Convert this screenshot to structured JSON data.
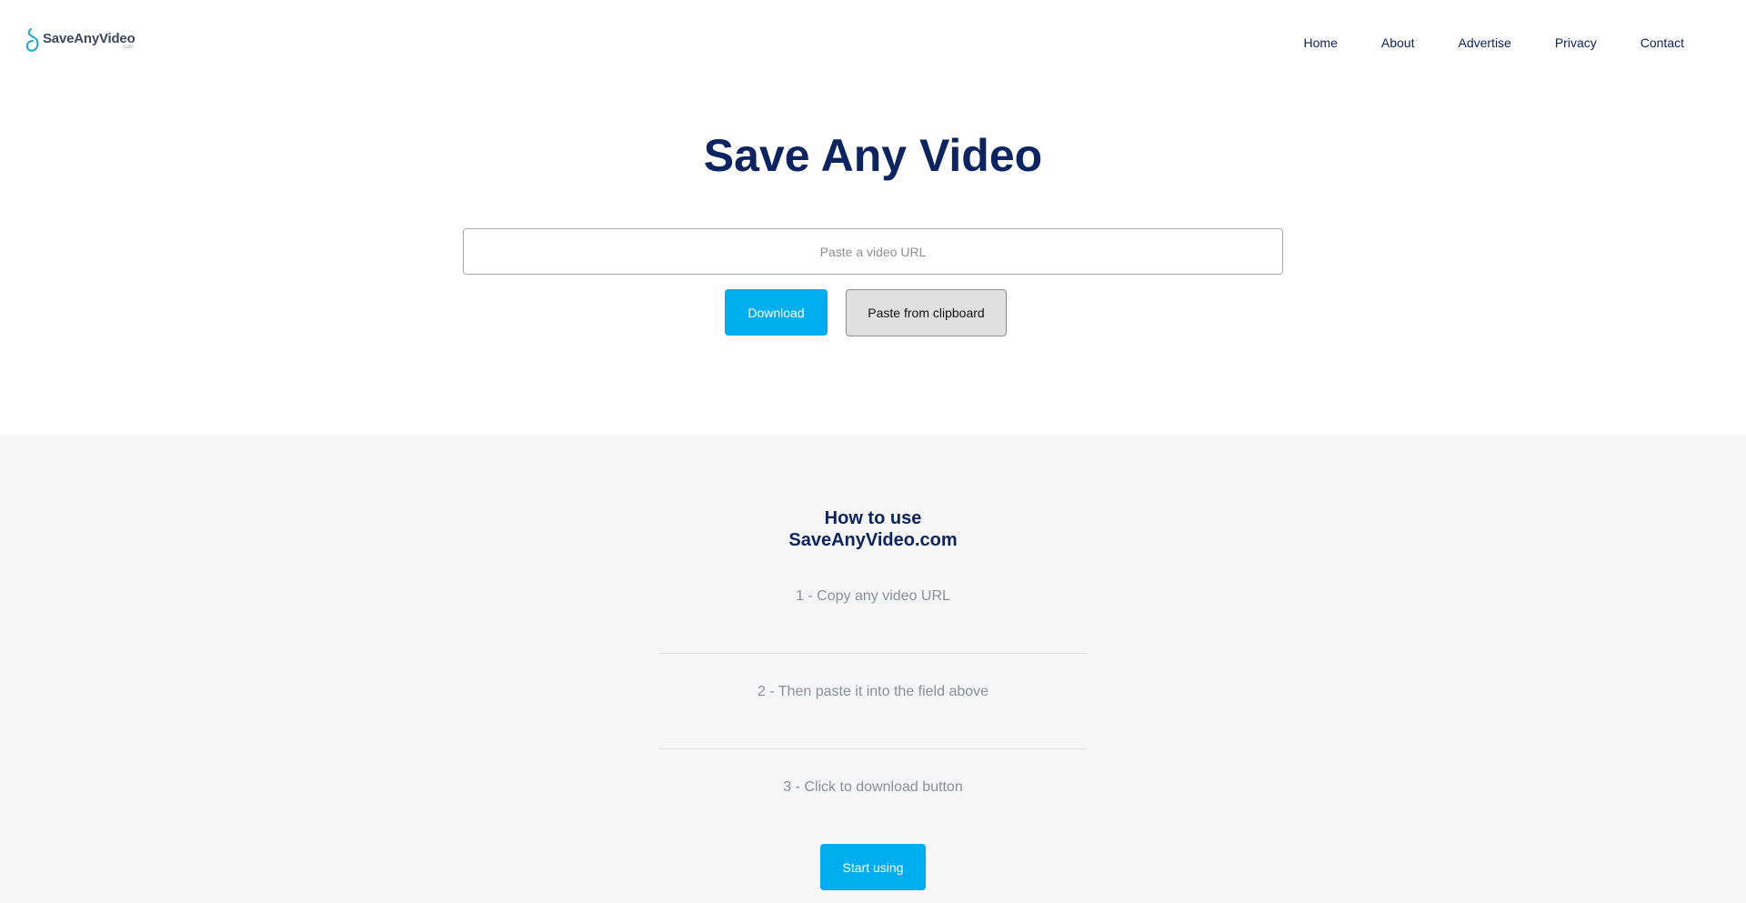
{
  "header": {
    "logo": {
      "name": "SaveAnyVideo",
      "tld": ".com"
    },
    "nav": [
      {
        "label": "Home"
      },
      {
        "label": "About"
      },
      {
        "label": "Advertise"
      },
      {
        "label": "Privacy"
      },
      {
        "label": "Contact"
      }
    ]
  },
  "hero": {
    "title": "Save Any Video",
    "url_input": {
      "value": "",
      "placeholder": "Paste a video URL"
    },
    "download_label": "Download",
    "paste_label": "Paste from clipboard"
  },
  "howto": {
    "title_line1": "How to use",
    "title_line2": "SaveAnyVideo.com",
    "steps": [
      "1 - Copy any video URL",
      "2 - Then paste it into the field above",
      "3 - Click to download button"
    ],
    "start_label": "Start using"
  },
  "colors": {
    "brand_navy": "#0c2461",
    "accent_blue": "#00adee",
    "section_bg": "#f6f6f6",
    "step_text": "#8a8f98"
  }
}
